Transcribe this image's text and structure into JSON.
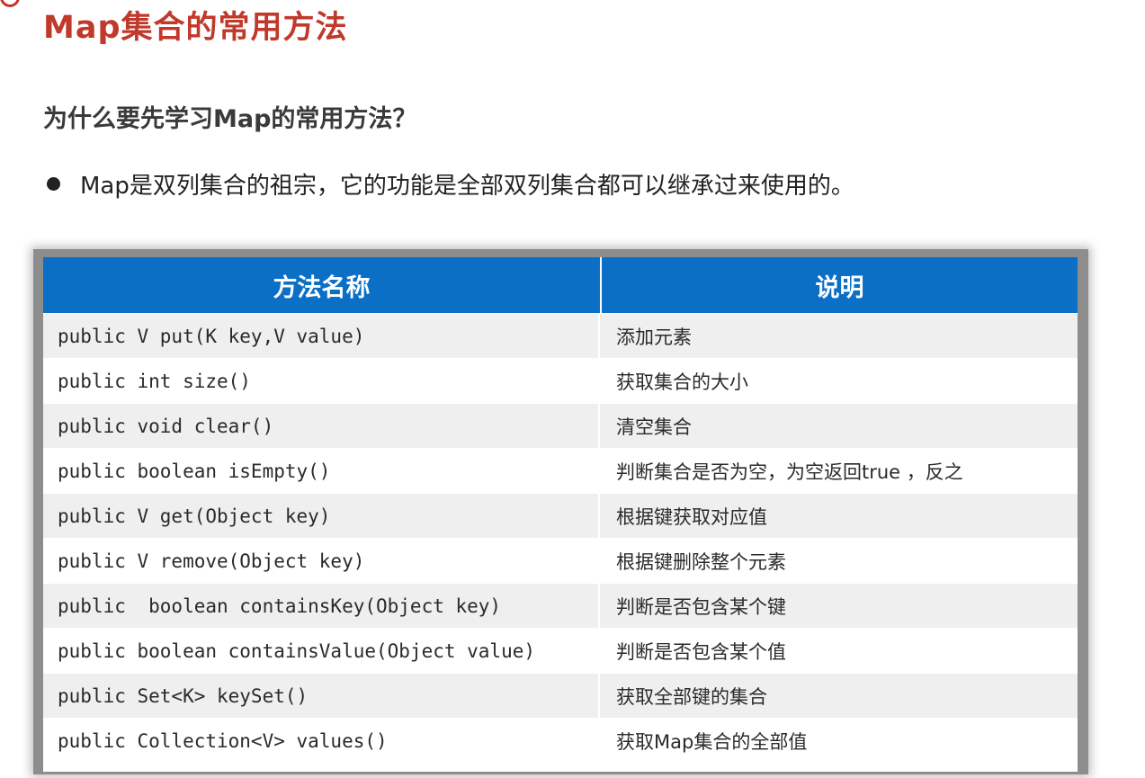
{
  "title": "Map集合的常用方法",
  "question": "为什么要先学习Map的常用方法？",
  "bullet": "Map是双列集合的祖宗，它的功能是全部双列集合都可以继承过来使用的。",
  "table": {
    "headers": [
      "方法名称",
      "说明"
    ],
    "rows": [
      {
        "method": "public V put(K key,V value)",
        "desc": "添加元素"
      },
      {
        "method": "public int size()",
        "desc": "获取集合的大小"
      },
      {
        "method": "public void clear()",
        "desc": "清空集合"
      },
      {
        "method": "public boolean isEmpty()",
        "desc": "判断集合是否为空，为空返回true ，反之"
      },
      {
        "method": "public V get(Object key)",
        "desc": "根据键获取对应值"
      },
      {
        "method": "public V remove(Object key)",
        "desc": "根据键删除整个元素"
      },
      {
        "method": "public  boolean containsKey(Object key)",
        "desc": "判断是否包含某个键"
      },
      {
        "method": "public boolean containsValue(Object value)",
        "desc": "判断是否包含某个值"
      },
      {
        "method": "public Set<K> keySet()",
        "desc": "获取全部键的集合"
      },
      {
        "method": "public Collection<V> values()",
        "desc": "获取Map集合的全部值"
      }
    ]
  },
  "colors": {
    "title": "#c0392b",
    "header_bg": "#0b6fc6",
    "row_alt": "#efefef"
  }
}
